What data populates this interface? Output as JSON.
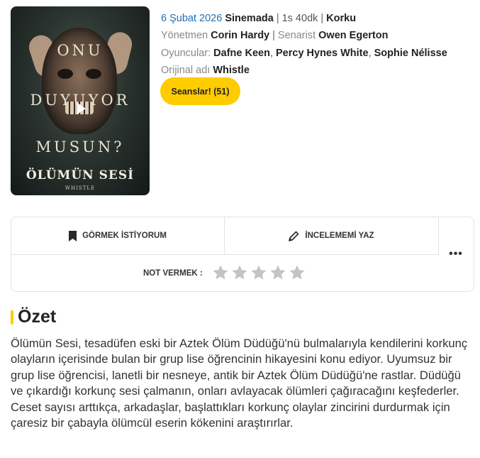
{
  "poster": {
    "text_line1": "ONU",
    "text_line2": "DUYUYOR",
    "text_line3": "MUSUN?",
    "title": "ÖLÜMÜN SESİ",
    "subtitle": "WHISTLE",
    "play_icon": "play-icon"
  },
  "details": {
    "release_date": "6 Şubat 2026",
    "venue": "Sinemada",
    "duration": "1s 40dk",
    "genre": "Korku",
    "director_label": "Yönetmen",
    "director": "Corin Hardy",
    "writer_label": "Senarist",
    "writer": "Owen Egerton",
    "cast_label": "Oyuncular:",
    "cast": [
      "Dafne Keen",
      "Percy Hynes White",
      "Sophie Nélisse"
    ],
    "original_title_label": "Orijinal adı",
    "original_title": "Whistle"
  },
  "seans_button": "Seanslar! (51)",
  "actions": {
    "watchlist_label": "GÖRMEK İSTİYORUM",
    "watchlist_icon": "bookmark-icon",
    "review_label": "İNCELEMEMİ YAZ",
    "review_icon": "pencil-icon",
    "more_label": "•••",
    "rate_label": "NOT VERMEK :",
    "stars": 5
  },
  "summary": {
    "heading": "Özet",
    "text": "Ölümün Sesi, tesadüfen eski bir Aztek Ölüm Düdüğü'nü bulmalarıyla kendilerini korkunç olayların içerisinde bulan bir grup lise öğrencinin hikayesini konu ediyor. Uyumsuz bir grup lise öğrencisi, lanetli bir nesneye, antik bir Aztek Ölüm Düdüğü'ne rastlar. Düdüğü ve çıkardığı korkunç sesi çalmanın, onları avlayacak ölümleri çağıracağını keşfederler. Ceset sayısı arttıkça, arkadaşlar, başlattıkları korkunç olaylar zincirini durdurmak için çaresiz bir çabayla ölümcül eserin kökenini araştırırlar."
  },
  "colors": {
    "accent": "#ffcc00",
    "link_blue": "#1d6fb8",
    "star_gray": "#c4c4c4"
  }
}
